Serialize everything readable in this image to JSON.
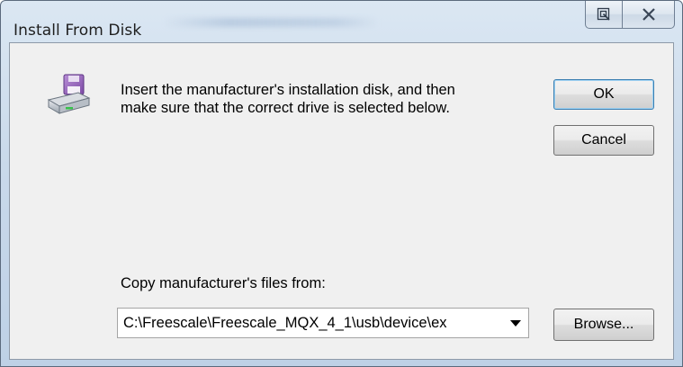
{
  "window": {
    "title": "Install From Disk",
    "help_icon": "context-help-icon",
    "close_icon": "close-icon"
  },
  "dialog": {
    "icon": "floppy-disk-drive-icon",
    "message_line1": "Insert the manufacturer's installation disk, and then",
    "message_line2": "make sure that the correct drive is selected below.",
    "ok_label": "OK",
    "cancel_label": "Cancel",
    "copy_from_label": "Copy manufacturer's files from:",
    "path_value": "C:\\Freescale\\Freescale_MQX_4_1\\usb\\device\\ex",
    "browse_label": "Browse..."
  },
  "colors": {
    "default_button_border": "#3c7fb1",
    "client_background": "#f0f0f0"
  }
}
